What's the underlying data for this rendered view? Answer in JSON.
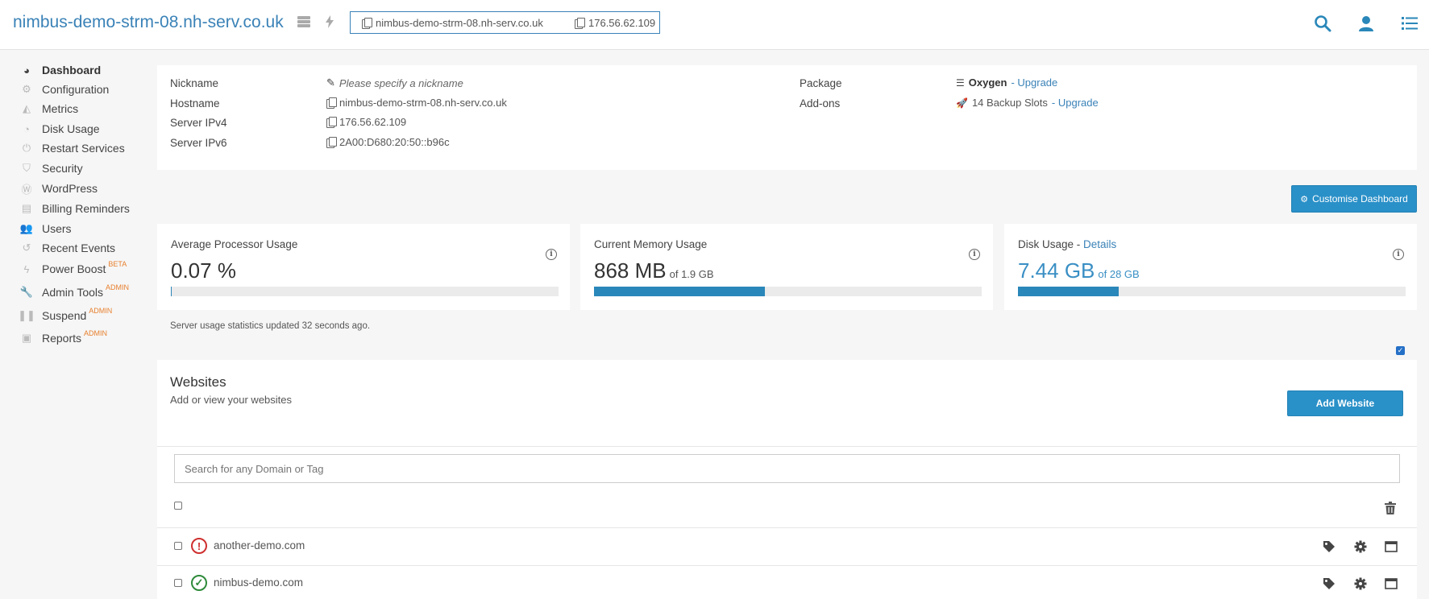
{
  "header": {
    "site_title": "nimbus-demo-strm-08.nh-serv.co.uk",
    "hostname": "nimbus-demo-strm-08.nh-serv.co.uk",
    "ip": "176.56.62.109",
    "icons": [
      "server-stack-icon",
      "lightning-icon",
      "search-icon",
      "user-icon",
      "list-icon"
    ]
  },
  "sidebar": {
    "items": [
      {
        "label": "Dashboard",
        "icon": "dashboard-icon",
        "badge": ""
      },
      {
        "label": "Configuration",
        "icon": "cogs-icon",
        "badge": ""
      },
      {
        "label": "Metrics",
        "icon": "area-chart-icon",
        "badge": ""
      },
      {
        "label": "Disk Usage",
        "icon": "pie-chart-icon",
        "badge": ""
      },
      {
        "label": "Restart Services",
        "icon": "power-icon",
        "badge": ""
      },
      {
        "label": "Security",
        "icon": "shield-icon",
        "badge": ""
      },
      {
        "label": "WordPress",
        "icon": "wordpress-icon",
        "badge": ""
      },
      {
        "label": "Billing Reminders",
        "icon": "document-icon",
        "badge": ""
      },
      {
        "label": "Users",
        "icon": "users-icon",
        "badge": ""
      },
      {
        "label": "Recent Events",
        "icon": "history-icon",
        "badge": ""
      },
      {
        "label": "Power Boost",
        "icon": "bolt-icon",
        "badge": "BETA"
      },
      {
        "label": "Admin Tools",
        "icon": "wrench-icon",
        "badge": "ADMIN"
      },
      {
        "label": "Suspend",
        "icon": "pause-icon",
        "badge": "ADMIN"
      },
      {
        "label": "Reports",
        "icon": "clipboard-icon",
        "badge": "ADMIN"
      }
    ]
  },
  "server_info": {
    "nickname_label": "Nickname",
    "nickname_placeholder": "Please specify a nickname",
    "hostname_label": "Hostname",
    "hostname_value": "nimbus-demo-strm-08.nh-serv.co.uk",
    "ipv4_label": "Server IPv4",
    "ipv4_value": "176.56.62.109",
    "ipv6_label": "Server IPv6",
    "ipv6_value": "2A00:D680:20:50::b96c",
    "package_label": "Package",
    "package_value": "Oxygen",
    "package_upgrade": "- Upgrade",
    "addons_label": "Add-ons",
    "addons_value": "14 Backup Slots",
    "addons_upgrade": "- Upgrade"
  },
  "customise_button": "Customise Dashboard",
  "stats": {
    "cpu": {
      "label": "Average Processor Usage",
      "value": "0.07 %",
      "of": "",
      "fraction": 0.0007
    },
    "memory": {
      "label": "Current Memory Usage",
      "value": "868 MB",
      "of": "of 1.9 GB",
      "fraction": 0.44
    },
    "disk": {
      "label": "Disk Usage",
      "details_link": "Details",
      "value": "7.44 GB",
      "of": "of 28 GB",
      "fraction": 0.26
    }
  },
  "usage_note": "Server usage statistics updated 32 seconds ago.",
  "websites": {
    "title": "Websites",
    "subtitle": "Add or view your websites",
    "add_button": "Add Website",
    "search_placeholder": "Search for any Domain or Tag",
    "rows": [
      {
        "domain": "another-demo.com",
        "status": "error"
      },
      {
        "domain": "nimbus-demo.com",
        "status": "ok"
      }
    ]
  },
  "colors": {
    "accent": "#2a90c8",
    "link": "#3a82b7",
    "bar_fill": "#2a87b9",
    "badge": "#e8802f",
    "error": "#cf2f2f",
    "ok": "#2e8a3a"
  }
}
